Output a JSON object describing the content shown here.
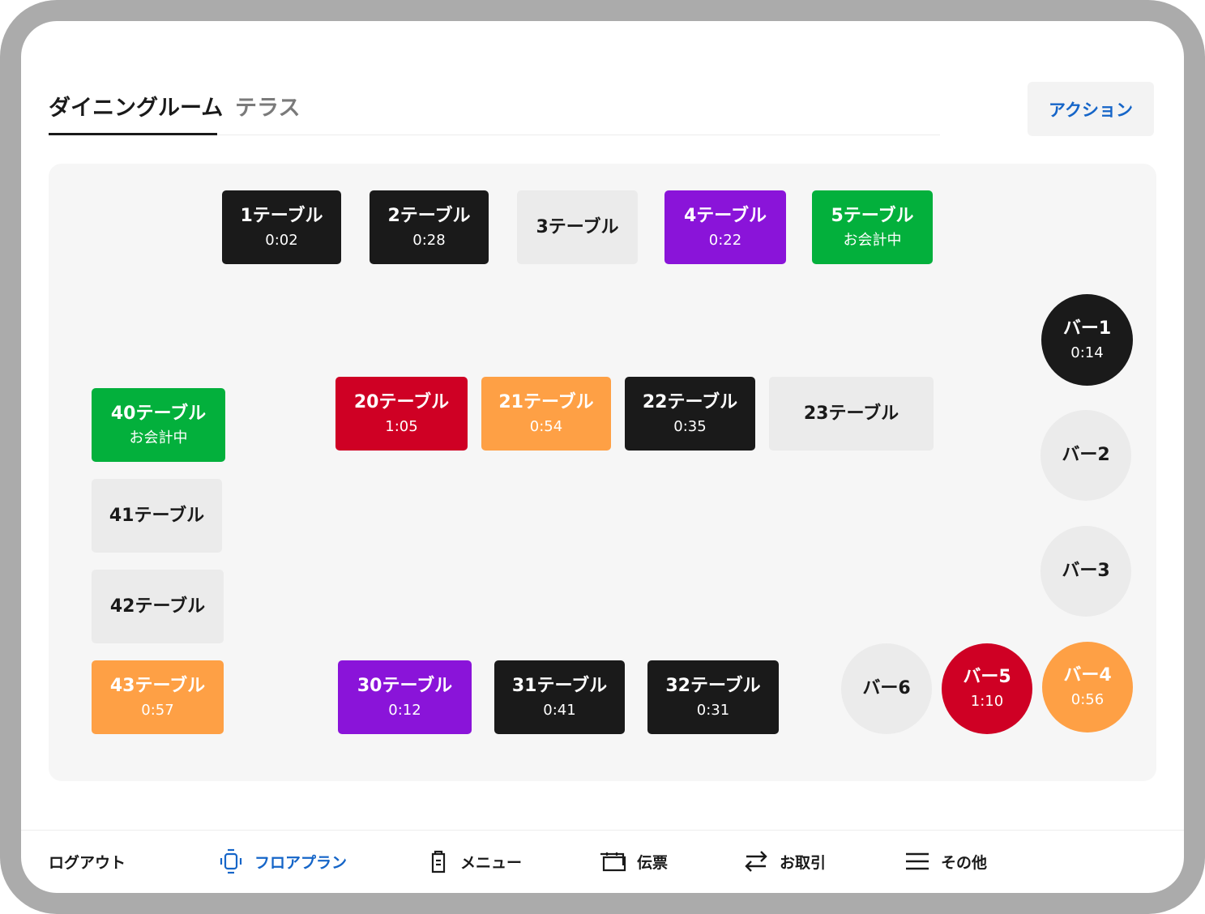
{
  "tabs": [
    {
      "label": "ダイニングルーム",
      "active": true
    },
    {
      "label": "テラス",
      "active": false
    }
  ],
  "action_label": "アクション",
  "tables": [
    {
      "name": "1テーブル",
      "status": "0:02",
      "state": "occupied"
    },
    {
      "name": "2テーブル",
      "status": "0:28",
      "state": "occupied"
    },
    {
      "name": "3テーブル",
      "status": "",
      "state": "empty"
    },
    {
      "name": "4テーブル",
      "status": "0:22",
      "state": "purple"
    },
    {
      "name": "5テーブル",
      "status": "お会計中",
      "state": "paying"
    },
    {
      "name": "20テーブル",
      "status": "1:05",
      "state": "late"
    },
    {
      "name": "21テーブル",
      "status": "0:54",
      "state": "warning"
    },
    {
      "name": "22テーブル",
      "status": "0:35",
      "state": "occupied"
    },
    {
      "name": "23テーブル",
      "status": "",
      "state": "empty"
    },
    {
      "name": "40テーブル",
      "status": "お会計中",
      "state": "paying"
    },
    {
      "name": "41テーブル",
      "status": "",
      "state": "empty"
    },
    {
      "name": "42テーブル",
      "status": "",
      "state": "empty"
    },
    {
      "name": "43テーブル",
      "status": "0:57",
      "state": "warning"
    },
    {
      "name": "30テーブル",
      "status": "0:12",
      "state": "purple"
    },
    {
      "name": "31テーブル",
      "status": "0:41",
      "state": "occupied"
    },
    {
      "name": "32テーブル",
      "status": "0:31",
      "state": "occupied"
    }
  ],
  "bars": [
    {
      "name": "バー1",
      "status": "0:14",
      "state": "occupied"
    },
    {
      "name": "バー2",
      "status": "",
      "state": "empty"
    },
    {
      "name": "バー3",
      "status": "",
      "state": "empty"
    },
    {
      "name": "バー4",
      "status": "0:56",
      "state": "warning"
    },
    {
      "name": "バー5",
      "status": "1:10",
      "state": "late"
    },
    {
      "name": "バー6",
      "status": "",
      "state": "empty"
    }
  ],
  "nav": {
    "logout": "ログアウト",
    "floorplan": "フロアプラン",
    "menu": "メニュー",
    "checks": "伝票",
    "transactions": "お取引",
    "more": "その他"
  },
  "colors": {
    "accent": "#1565c8",
    "occupied": "#1a1a1a",
    "empty": "#ebebeb",
    "purple": "#8a14d9",
    "paying": "#03b03c",
    "late": "#cf0024",
    "warning": "#fea045"
  }
}
